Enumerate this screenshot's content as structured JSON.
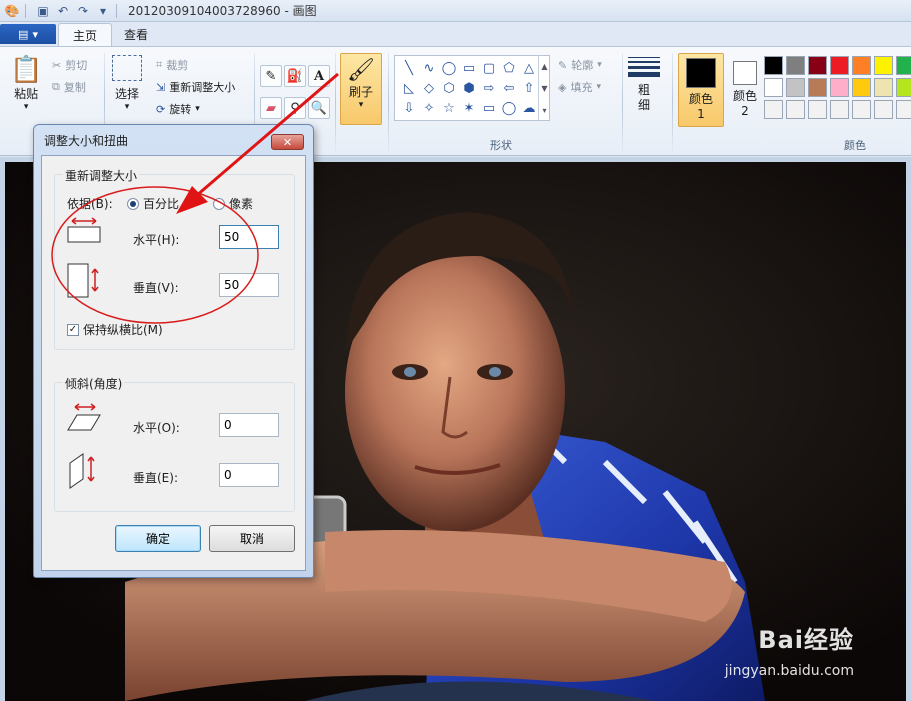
{
  "window": {
    "title": "20120309104003728960 - 画图"
  },
  "tabs": [
    {
      "label": "主页",
      "active": true
    },
    {
      "label": "查看",
      "active": false
    }
  ],
  "ribbon": {
    "paste": {
      "label": "粘贴"
    },
    "cut": {
      "label": "剪切"
    },
    "copy": {
      "label": "复制"
    },
    "select": {
      "label": "选择"
    },
    "crop": {
      "label": "裁剪"
    },
    "resize": {
      "label": "重新调整大小"
    },
    "rotate": {
      "label": "旋转"
    },
    "brush": {
      "label": "刷子"
    },
    "outline": {
      "label": "轮廓"
    },
    "fill": {
      "label": "填充"
    },
    "size": {
      "label": "粗细"
    },
    "color1": {
      "label": "颜色 1",
      "value": "#000000"
    },
    "color2": {
      "label": "颜色 2",
      "value": "#ffffff"
    },
    "groups": {
      "shapes": "形状",
      "colors": "颜色"
    },
    "shapes": [
      "╲",
      "∿",
      "◯",
      "▭",
      "▢",
      "⬠",
      "△",
      "◺",
      "◇",
      "⬡",
      "⬢",
      "⇨",
      "⇦",
      "⇧",
      "⇩",
      "✧",
      "☆",
      "✶",
      "▭",
      "◯",
      "☁"
    ],
    "palette": [
      "#000000",
      "#7f7f7f",
      "#880015",
      "#ed1c24",
      "#ff7f27",
      "#fff200",
      "#22b14c",
      "#ffffff",
      "#c3c3c3",
      "#b97a57",
      "#ffaec9",
      "#ffc90e",
      "#efe4b0",
      "#b5e61d",
      "#f2f2f2",
      "#f2f2f2",
      "#f2f2f2",
      "#f2f2f2",
      "#f2f2f2",
      "#f2f2f2",
      "#f2f2f2"
    ]
  },
  "dialog": {
    "title": "调整大小和扭曲",
    "resize_group": "重新调整大小",
    "by_label": "依据(B):",
    "percent_label": "百分比",
    "pixels_label": "像素",
    "horizontal_label": "水平(H):",
    "horizontal_value": "50",
    "vertical_label": "垂直(V):",
    "vertical_value": "50",
    "keep_ratio_label": "保持纵横比(M)",
    "skew_group": "倾斜(角度)",
    "skew_h_label": "水平(O):",
    "skew_h_value": "0",
    "skew_v_label": "垂直(E):",
    "skew_v_value": "0",
    "ok_label": "确定",
    "cancel_label": "取消"
  },
  "watermark": {
    "brand": "Bai经验",
    "url": "jingyan.baidu.com"
  }
}
